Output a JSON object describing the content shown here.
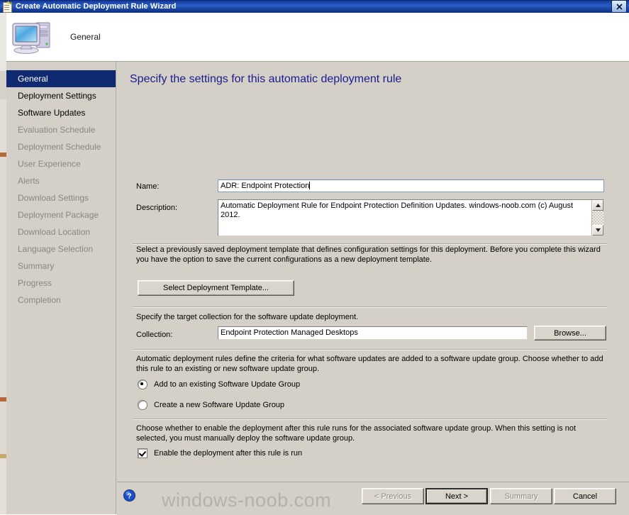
{
  "window": {
    "title": "Create Automatic Deployment Rule Wizard",
    "title_icon": "wizard-document-icon",
    "close_label": "✕",
    "titlebar_color": "#0a246a",
    "face_color": "#d4d0c8"
  },
  "header": {
    "step_label": "General",
    "icon": "computer-monitor-icon"
  },
  "sidebar": {
    "items": [
      {
        "label": "General",
        "state": "selected"
      },
      {
        "label": "Deployment Settings",
        "state": "enabled"
      },
      {
        "label": "Software Updates",
        "state": "enabled"
      },
      {
        "label": "Evaluation Schedule",
        "state": "disabled"
      },
      {
        "label": "Deployment Schedule",
        "state": "disabled"
      },
      {
        "label": "User Experience",
        "state": "disabled"
      },
      {
        "label": "Alerts",
        "state": "disabled"
      },
      {
        "label": "Download Settings",
        "state": "disabled"
      },
      {
        "label": "Deployment Package",
        "state": "disabled"
      },
      {
        "label": "Download Location",
        "state": "disabled"
      },
      {
        "label": "Language Selection",
        "state": "disabled"
      },
      {
        "label": "Summary",
        "state": "disabled"
      },
      {
        "label": "Progress",
        "state": "disabled"
      },
      {
        "label": "Completion",
        "state": "disabled"
      }
    ],
    "selected_color": "#0f2a70"
  },
  "main": {
    "page_title": "Specify the settings for this automatic deployment rule",
    "page_title_color": "#1b1b8f",
    "name": {
      "label": "Name:",
      "value": "ADR: Endpoint Protection",
      "placeholder": ""
    },
    "description": {
      "label": "Description:",
      "value": "Automatic Deployment Rule for Endpoint Protection Definition Updates. windows-noob.com (c) August 2012.",
      "placeholder": "",
      "scroll_up_icon": "scroll-up-arrow-icon",
      "scroll_down_icon": "scroll-down-arrow-icon"
    },
    "template_section": {
      "paragraph": "Select a previously saved deployment template that defines configuration settings for this deployment. Before you complete this wizard you have the option to save the current configurations as a new deployment template.",
      "button_label": "Select Deployment Template..."
    },
    "collection_section": {
      "paragraph": "Specify the target collection for the software update deployment.",
      "label": "Collection:",
      "value": "Endpoint Protection Managed Desktops",
      "browse_label": "Browse..."
    },
    "group_section": {
      "paragraph": "Automatic deployment rules define the criteria for what software updates are added to a software update group. Choose whether to add this rule to an existing or new software update group.",
      "options": [
        {
          "label": "Add to an existing Software Update Group",
          "checked": true
        },
        {
          "label": "Create a new Software Update Group",
          "checked": false
        }
      ]
    },
    "enable_section": {
      "paragraph": "Choose whether to enable the deployment after this rule runs for the associated software update group. When this setting is not selected, you must manually deploy the software update group.",
      "checkbox": {
        "label": "Enable the deployment after this rule is run",
        "checked": true
      }
    }
  },
  "footer": {
    "help_icon": "help-question-icon",
    "buttons": [
      {
        "label": "< Previous",
        "state": "disabled",
        "name": "previous-button"
      },
      {
        "label": "Next >",
        "state": "default",
        "name": "next-button"
      },
      {
        "label": "Summary",
        "state": "disabled",
        "name": "summary-button"
      },
      {
        "label": "Cancel",
        "state": "enabled",
        "name": "cancel-button"
      }
    ]
  },
  "watermark": {
    "text": "windows-noob.com"
  }
}
